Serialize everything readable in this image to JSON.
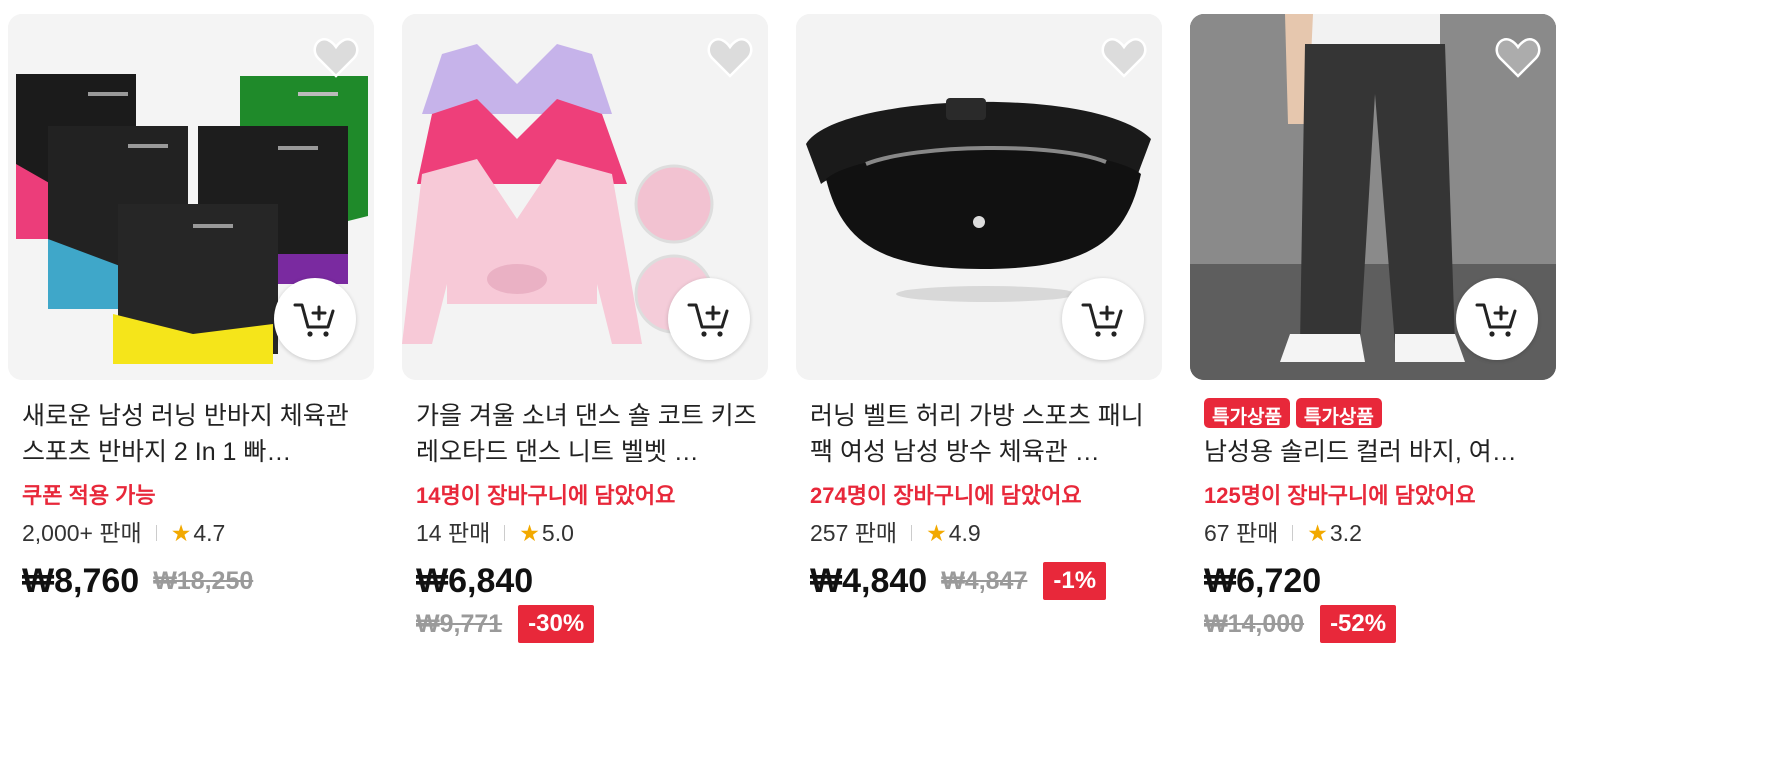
{
  "products": [
    {
      "title": "새로운 남성 러닝 반바지 체육관 스포츠 반바지 2 In 1 빠…",
      "promo": "쿠폰 적용 가능",
      "sold": "2,000+ 판매",
      "rating": "4.7",
      "price": "₩8,760",
      "original_price": "₩18,250",
      "discount": ""
    },
    {
      "title": "가을 겨울 소녀 댄스 숄 코트 키즈 레오타드 댄스 니트 벨벳 …",
      "promo": "14명이 장바구니에 담았어요",
      "sold": "14 판매",
      "rating": "5.0",
      "price": "₩6,840",
      "original_price": "₩9,771",
      "discount": "-30%"
    },
    {
      "title": "러닝 벨트 허리 가방 스포츠 패니 팩 여성 남성 방수 체육관 …",
      "promo": "274명이 장바구니에 담았어요",
      "sold": "257 판매",
      "rating": "4.9",
      "price": "₩4,840",
      "original_price": "₩4,847",
      "discount": "-1%"
    },
    {
      "badges": [
        "특가상품",
        "특가상품"
      ],
      "title": "남성용 솔리드 컬러 바지, 여…",
      "promo": "125명이 장바구니에 담았어요",
      "sold": "67 판매",
      "rating": "3.2",
      "price": "₩6,720",
      "original_price": "₩14,000",
      "discount": "-52%"
    }
  ],
  "icons": {
    "heart": "heart-icon",
    "cart": "add-to-cart-icon",
    "star": "star-icon"
  },
  "colors": {
    "accent": "#e8283a",
    "star": "#f2a900",
    "strikethrough": "#9a9a9a"
  }
}
